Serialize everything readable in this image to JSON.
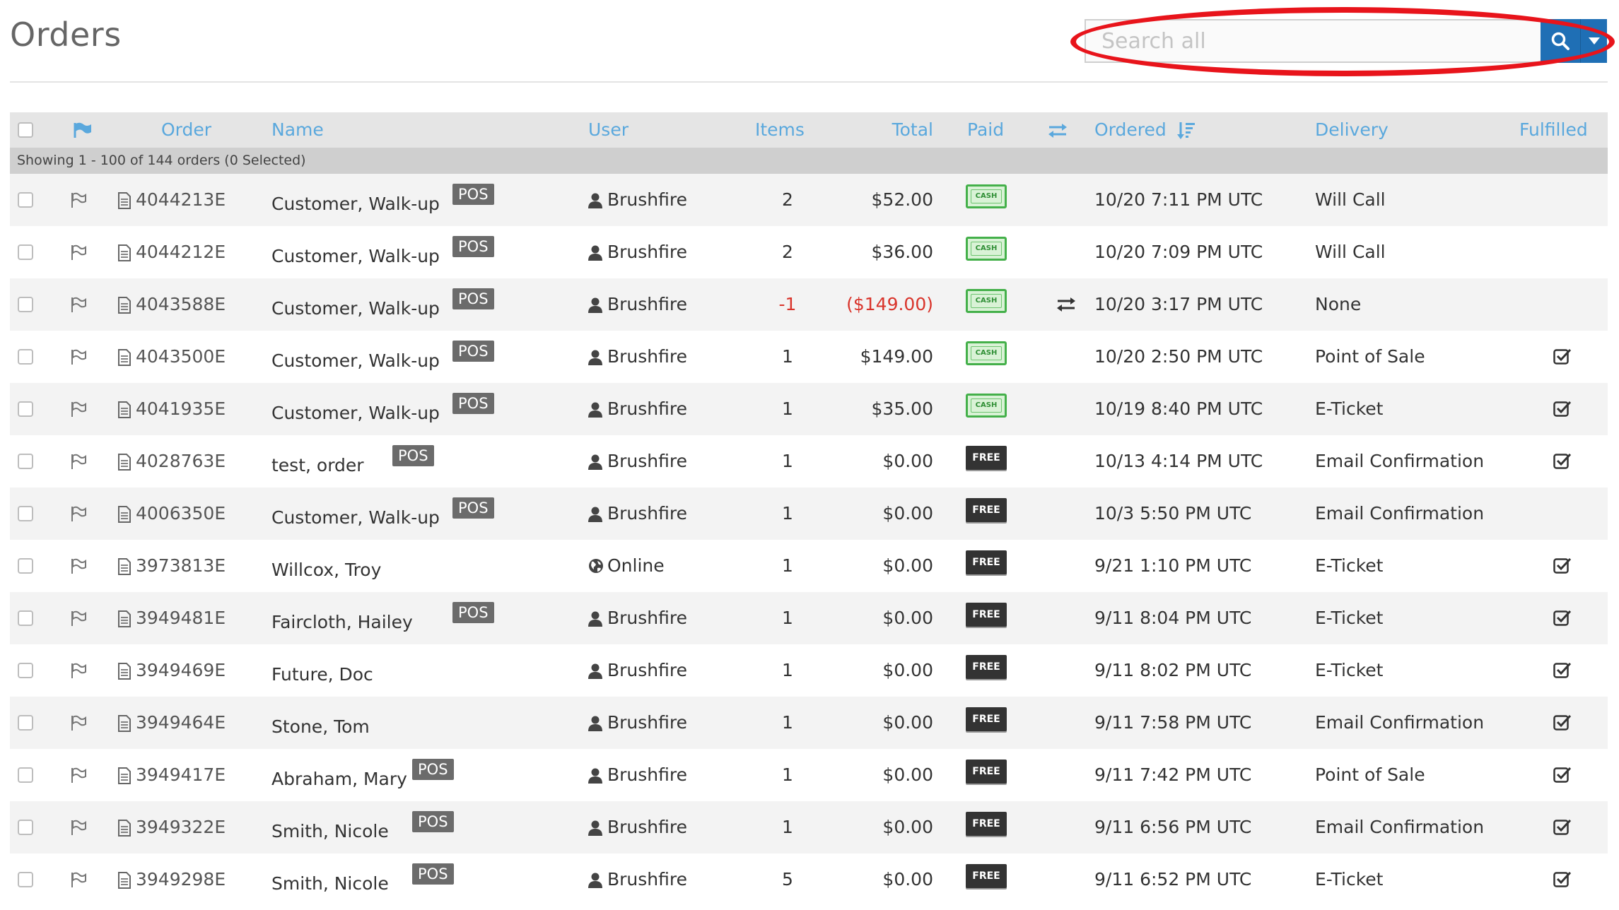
{
  "page": {
    "title": "Orders"
  },
  "search": {
    "placeholder": "Search all",
    "value": ""
  },
  "colors": {
    "accent": "#1f6fb5",
    "header_text": "#5aa8dd",
    "negative": "#d9342b",
    "highlight": "#e8141b"
  },
  "icons": {
    "search_button": "search-icon",
    "search_dropdown": "caret-down-icon",
    "header_flag": "flag-icon",
    "header_transfer": "exchange-icon",
    "header_sort": "sort-amount-desc-icon",
    "row_flag": "flag-outline-icon",
    "row_order": "document-icon",
    "user_pos": "user-icon",
    "user_online": "globe-icon",
    "fulfilled": "checkbox-checked-icon",
    "paid_cash": "cash-badge-icon"
  },
  "table": {
    "columns": {
      "order": "Order",
      "name": "Name",
      "user": "User",
      "items": "Items",
      "total": "Total",
      "paid": "Paid",
      "ordered": "Ordered",
      "delivery": "Delivery",
      "fulfilled": "Fulfilled"
    },
    "summary": "Showing 1 - 100 of 144 orders (0 Selected)",
    "rows": [
      {
        "order": "4044213E",
        "name": "Customer, Walk-up",
        "pos": "POS",
        "user": "Brushfire",
        "user_type": "user",
        "items": "2",
        "total": "$52.00",
        "negative": false,
        "paid": "CASH",
        "refund": false,
        "ordered": "10/20 7:11 PM UTC",
        "delivery": "Will Call",
        "fulfilled": false
      },
      {
        "order": "4044212E",
        "name": "Customer, Walk-up",
        "pos": "POS",
        "user": "Brushfire",
        "user_type": "user",
        "items": "2",
        "total": "$36.00",
        "negative": false,
        "paid": "CASH",
        "refund": false,
        "ordered": "10/20 7:09 PM UTC",
        "delivery": "Will Call",
        "fulfilled": false
      },
      {
        "order": "4043588E",
        "name": "Customer, Walk-up",
        "pos": "POS",
        "user": "Brushfire",
        "user_type": "user",
        "items": "-1",
        "total": "($149.00)",
        "negative": true,
        "paid": "CASH",
        "refund": true,
        "ordered": "10/20 3:17 PM UTC",
        "delivery": "None",
        "fulfilled": false
      },
      {
        "order": "4043500E",
        "name": "Customer, Walk-up",
        "pos": "POS",
        "user": "Brushfire",
        "user_type": "user",
        "items": "1",
        "total": "$149.00",
        "negative": false,
        "paid": "CASH",
        "refund": false,
        "ordered": "10/20 2:50 PM UTC",
        "delivery": "Point of Sale",
        "fulfilled": true
      },
      {
        "order": "4041935E",
        "name": "Customer, Walk-up",
        "pos": "POS",
        "user": "Brushfire",
        "user_type": "user",
        "items": "1",
        "total": "$35.00",
        "negative": false,
        "paid": "CASH",
        "refund": false,
        "ordered": "10/19 8:40 PM UTC",
        "delivery": "E-Ticket",
        "fulfilled": true
      },
      {
        "order": "4028763E",
        "name": "test, order",
        "pos": "POS",
        "user": "Brushfire",
        "user_type": "user",
        "items": "1",
        "total": "$0.00",
        "negative": false,
        "paid": "FREE",
        "refund": false,
        "ordered": "10/13 4:14 PM UTC",
        "delivery": "Email Confirmation",
        "fulfilled": true
      },
      {
        "order": "4006350E",
        "name": "Customer, Walk-up",
        "pos": "POS",
        "user": "Brushfire",
        "user_type": "user",
        "items": "1",
        "total": "$0.00",
        "negative": false,
        "paid": "FREE",
        "refund": false,
        "ordered": "10/3 5:50 PM UTC",
        "delivery": "Email Confirmation",
        "fulfilled": false
      },
      {
        "order": "3973813E",
        "name": "Willcox, Troy",
        "pos": "",
        "user": "Online",
        "user_type": "online",
        "items": "1",
        "total": "$0.00",
        "negative": false,
        "paid": "FREE",
        "refund": false,
        "ordered": "9/21 1:10 PM UTC",
        "delivery": "E-Ticket",
        "fulfilled": true
      },
      {
        "order": "3949481E",
        "name": "Faircloth, Hailey",
        "pos": "POS",
        "user": "Brushfire",
        "user_type": "user",
        "items": "1",
        "total": "$0.00",
        "negative": false,
        "paid": "FREE",
        "refund": false,
        "ordered": "9/11 8:04 PM UTC",
        "delivery": "E-Ticket",
        "fulfilled": true
      },
      {
        "order": "3949469E",
        "name": "Future, Doc",
        "pos": "",
        "user": "Brushfire",
        "user_type": "user",
        "items": "1",
        "total": "$0.00",
        "negative": false,
        "paid": "FREE",
        "refund": false,
        "ordered": "9/11 8:02 PM UTC",
        "delivery": "E-Ticket",
        "fulfilled": true
      },
      {
        "order": "3949464E",
        "name": "Stone, Tom",
        "pos": "",
        "user": "Brushfire",
        "user_type": "user",
        "items": "1",
        "total": "$0.00",
        "negative": false,
        "paid": "FREE",
        "refund": false,
        "ordered": "9/11 7:58 PM UTC",
        "delivery": "Email Confirmation",
        "fulfilled": true
      },
      {
        "order": "3949417E",
        "name": "Abraham, Mary",
        "pos": "POS",
        "user": "Brushfire",
        "user_type": "user",
        "items": "1",
        "total": "$0.00",
        "negative": false,
        "paid": "FREE",
        "refund": false,
        "ordered": "9/11 7:42 PM UTC",
        "delivery": "Point of Sale",
        "fulfilled": true
      },
      {
        "order": "3949322E",
        "name": "Smith, Nicole",
        "pos": "POS",
        "user": "Brushfire",
        "user_type": "user",
        "items": "1",
        "total": "$0.00",
        "negative": false,
        "paid": "FREE",
        "refund": false,
        "ordered": "9/11 6:56 PM UTC",
        "delivery": "Email Confirmation",
        "fulfilled": true
      },
      {
        "order": "3949298E",
        "name": "Smith, Nicole",
        "pos": "POS",
        "user": "Brushfire",
        "user_type": "user",
        "items": "5",
        "total": "$0.00",
        "negative": false,
        "paid": "FREE",
        "refund": false,
        "ordered": "9/11 6:52 PM UTC",
        "delivery": "E-Ticket",
        "fulfilled": true
      }
    ]
  }
}
